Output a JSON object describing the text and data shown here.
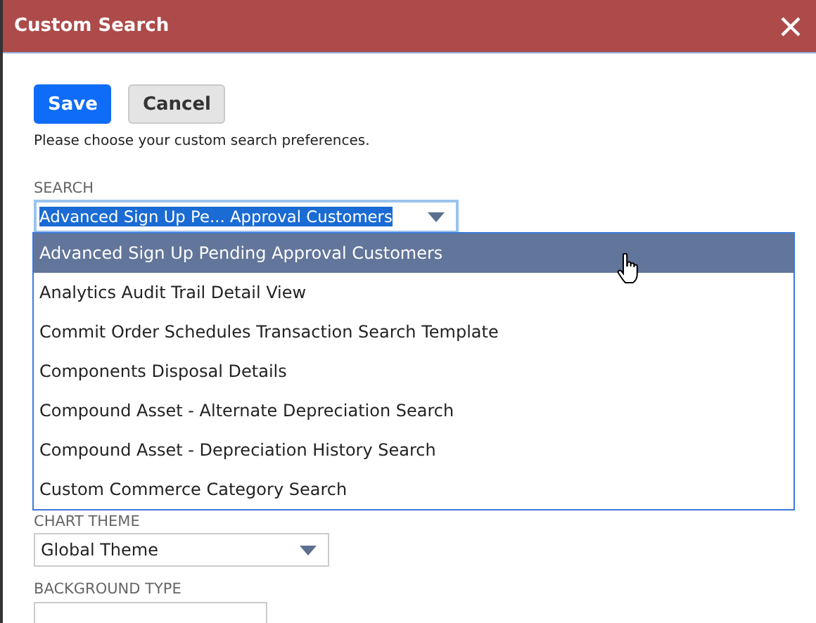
{
  "window": {
    "title": "Custom Search"
  },
  "buttons": [
    {
      "label": "Save",
      "kind": "primary"
    },
    {
      "label": "Cancel",
      "kind": "secondary"
    }
  ],
  "instructions": "Please choose your custom search preferences.",
  "search": {
    "label": "SEARCH",
    "value": "Advanced Sign Up Pe... Approval Customers",
    "expanded": true,
    "options": [
      {
        "label": "Advanced Sign Up Pending Approval Customers",
        "selected": true
      },
      {
        "label": "Analytics Audit Trail Detail View",
        "selected": false
      },
      {
        "label": "Commit Order Schedules Transaction Search Template",
        "selected": false
      },
      {
        "label": "Components Disposal Details",
        "selected": false
      },
      {
        "label": "Compound Asset - Alternate Depreciation Search",
        "selected": false
      },
      {
        "label": "Compound Asset - Depreciation History Search",
        "selected": false
      },
      {
        "label": "Custom Commerce Category Search",
        "selected": false
      }
    ]
  },
  "chart_theme": {
    "label": "CHART THEME",
    "value": "Global Theme"
  },
  "background_type": {
    "label": "BACKGROUND TYPE"
  }
}
